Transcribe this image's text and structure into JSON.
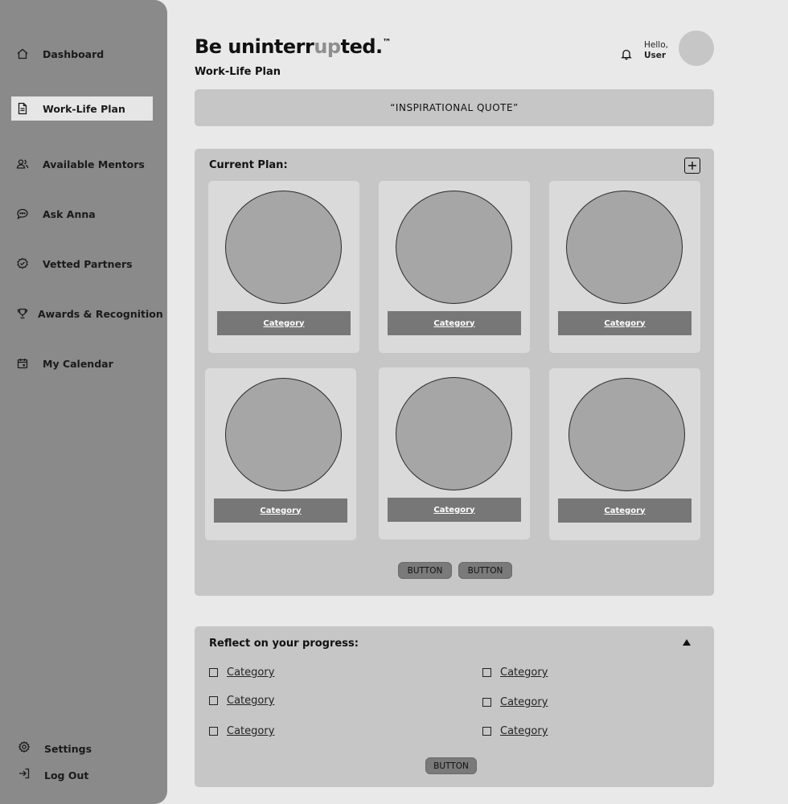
{
  "sidebar": {
    "items": [
      {
        "label": "Dashboard",
        "icon": "home-icon"
      },
      {
        "label": "Work-Life Plan",
        "icon": "document-icon",
        "active": true
      },
      {
        "label": "Available Mentors",
        "icon": "users-icon"
      },
      {
        "label": "Ask Anna",
        "icon": "chat-icon"
      },
      {
        "label": "Vetted Partners",
        "icon": "badge-check-icon"
      },
      {
        "label": "Awards & Recognition",
        "icon": "trophy-icon"
      },
      {
        "label": "My Calendar",
        "icon": "calendar-icon"
      }
    ],
    "footer": [
      {
        "label": "Settings",
        "icon": "gear-icon"
      },
      {
        "label": "Log Out",
        "icon": "logout-icon"
      }
    ]
  },
  "header": {
    "brand_prefix": "Be uninterr",
    "brand_highlight": "up",
    "brand_suffix": "ted.",
    "brand_mark": "™",
    "page_title": "Work-Life Plan",
    "greeting": "Hello,",
    "username": "User"
  },
  "quote": "“INSPIRATIONAL QUOTE”",
  "plan": {
    "title": "Current Plan:",
    "cards": [
      {
        "label": "Category"
      },
      {
        "label": "Category"
      },
      {
        "label": "Category"
      },
      {
        "label": "Category"
      },
      {
        "label": "Category"
      },
      {
        "label": "Category"
      }
    ],
    "buttons": [
      "BUTTON",
      "BUTTON"
    ]
  },
  "reflect": {
    "title": "Reflect on your progress:",
    "items": [
      "Category",
      "Category",
      "Category",
      "Category",
      "Category",
      "Category"
    ],
    "button": "BUTTON"
  },
  "colors": {
    "sidebar": "#8a8a8a",
    "panel": "#c6c6c6",
    "card": "#dadada",
    "category_bar": "#777777",
    "background": "#e9e9e9"
  }
}
